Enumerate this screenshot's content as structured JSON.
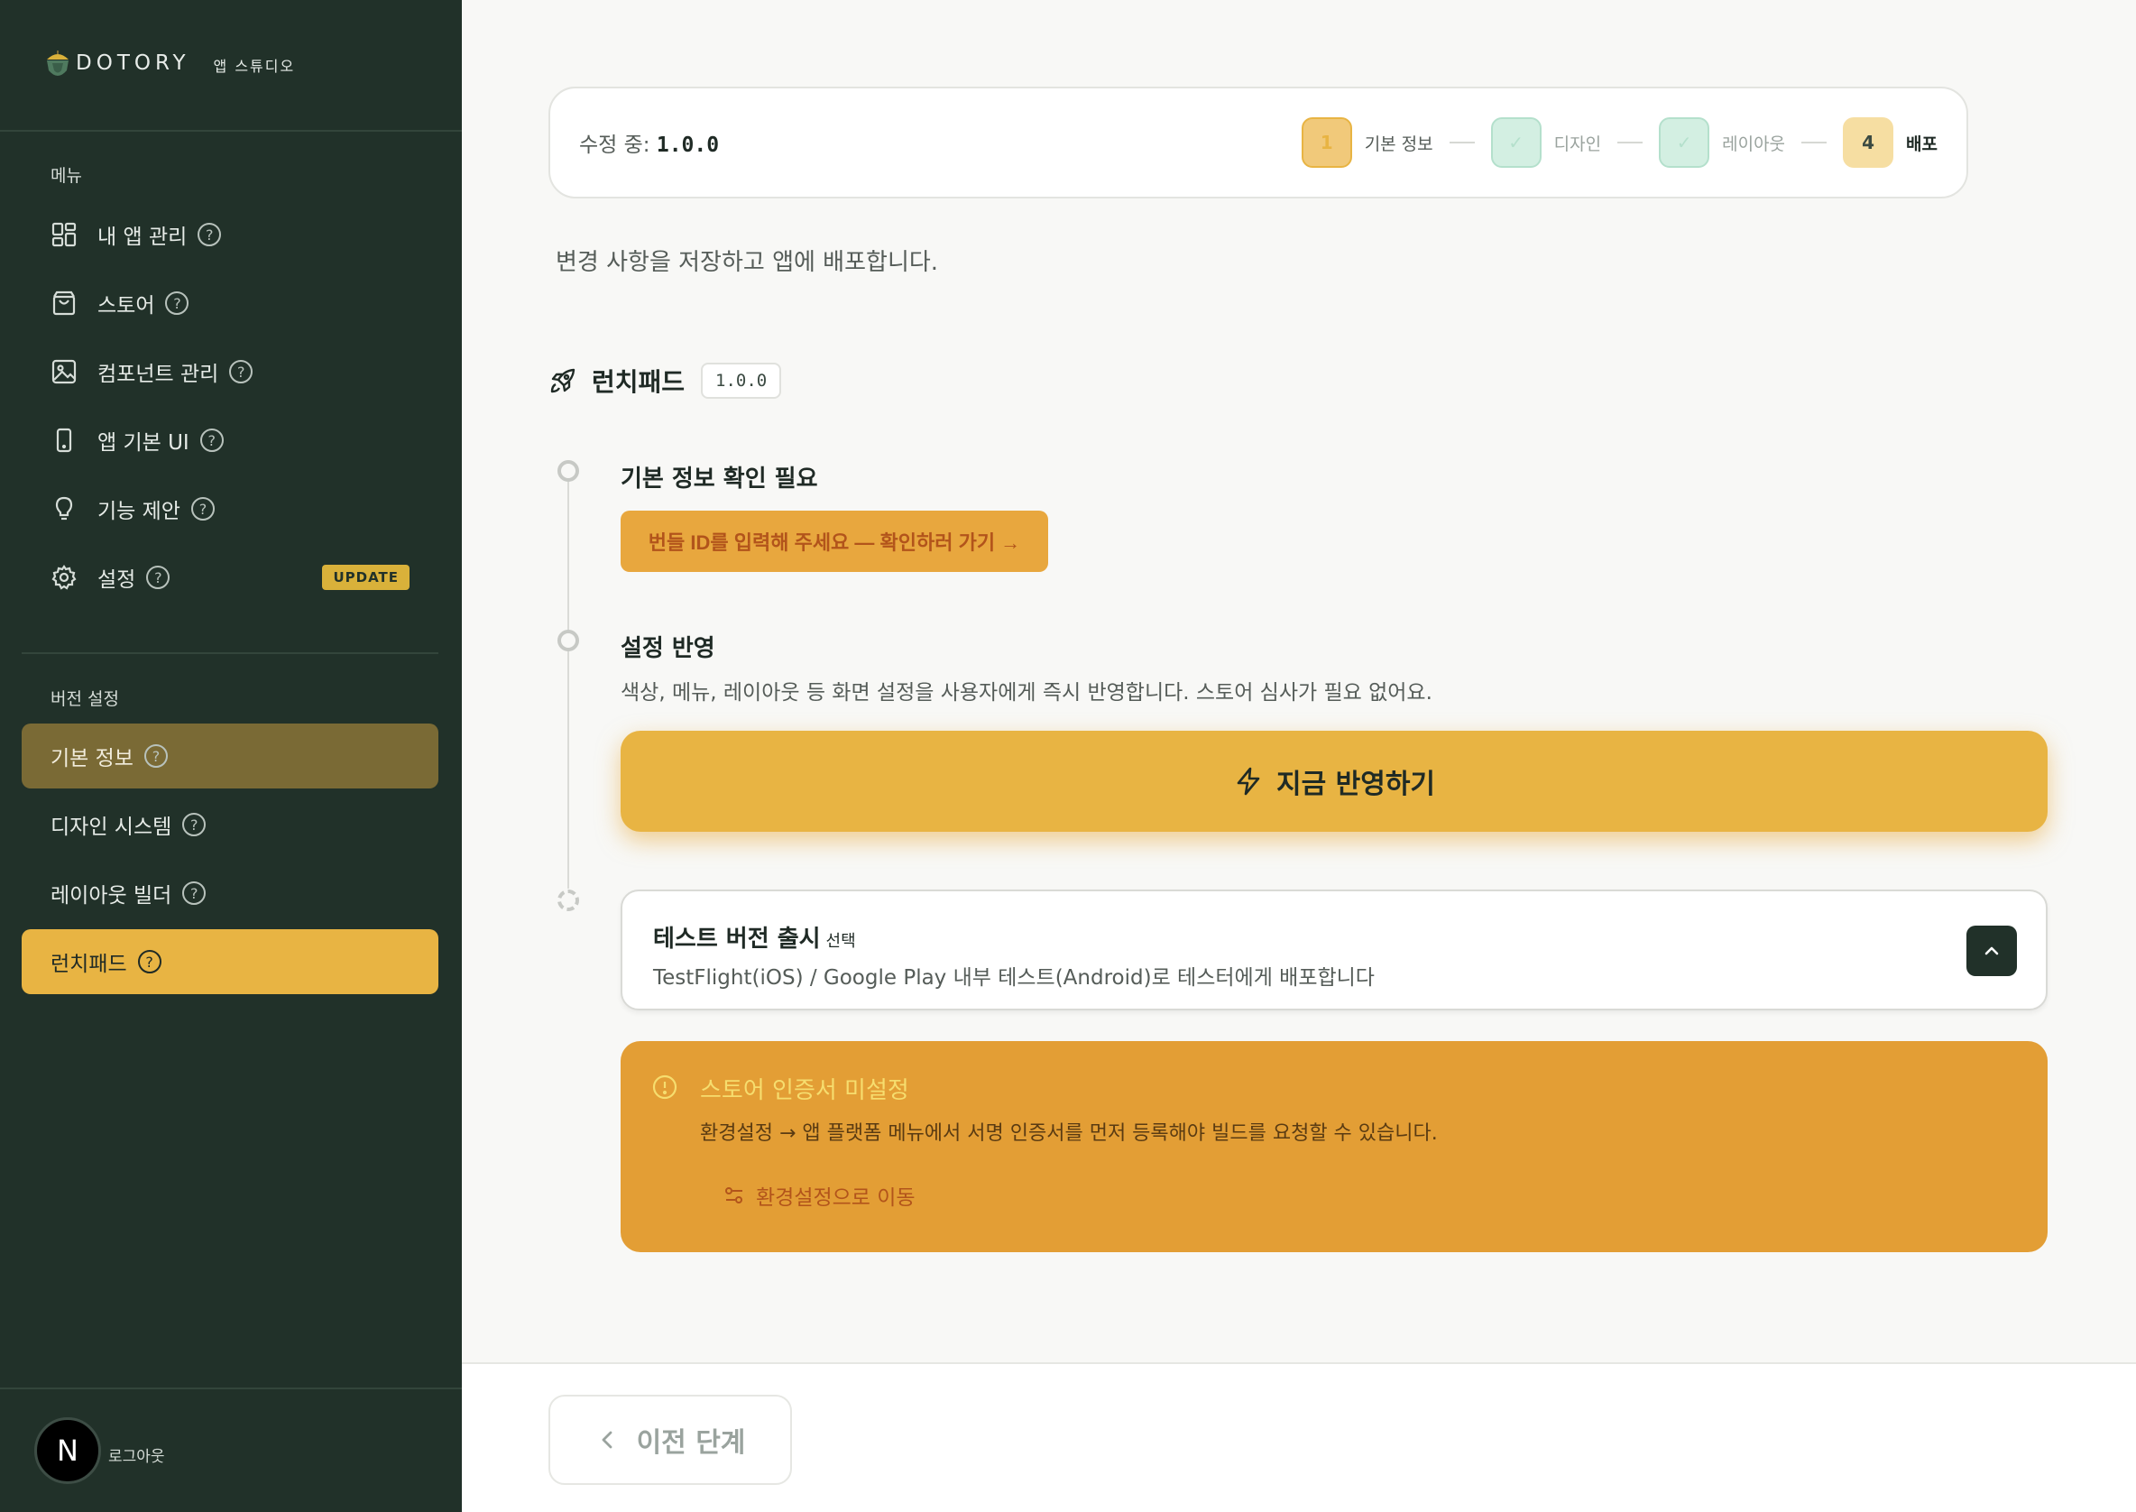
{
  "brand": {
    "name": "DOTORY",
    "subtitle": "앱 스튜디오"
  },
  "sidebar": {
    "menu_label": "메뉴",
    "items": [
      {
        "label": "내 앱 관리",
        "icon": "grid-icon"
      },
      {
        "label": "스토어",
        "icon": "bag-icon"
      },
      {
        "label": "컴포넌트 관리",
        "icon": "image-icon"
      },
      {
        "label": "앱 기본 UI",
        "icon": "phone-icon"
      },
      {
        "label": "기능 제안",
        "icon": "lightbulb-icon"
      },
      {
        "label": "설정",
        "icon": "gear-icon",
        "badge": "UPDATE"
      }
    ],
    "version_label": "버전 설정",
    "version_items": [
      {
        "label": "기본 정보",
        "state": "done"
      },
      {
        "label": "디자인 시스템",
        "state": "idle"
      },
      {
        "label": "레이아웃 빌더",
        "state": "idle"
      },
      {
        "label": "런치패드",
        "state": "active"
      }
    ],
    "help_glyph": "?",
    "user": {
      "avatar_letter": "N",
      "logout": "로그아웃"
    }
  },
  "header": {
    "editing_prefix": "수정 중: ",
    "editing_version": "1.0.0",
    "steps": [
      {
        "num": "1",
        "label": "기본 정보"
      },
      {
        "num": "✓",
        "label": "디자인"
      },
      {
        "num": "✓",
        "label": "레이아웃"
      },
      {
        "num": "4",
        "label": "배포"
      }
    ]
  },
  "main": {
    "subtitle": "변경 사항을 저장하고 앱에 배포합니다.",
    "launchpad_title": "런치패드",
    "launchpad_version": "1.0.0",
    "step1_title": "기본 정보 확인 필요",
    "step1_button": "번들 ID를 입력해 주세요 — 확인하러 가기 →",
    "step2_title": "설정 반영",
    "step2_desc": "색상, 메뉴, 레이아웃 등 화면 설정을 사용자에게 즉시 반영합니다. 스토어 심사가 필요 없어요.",
    "apply_button": "지금 반영하기",
    "test_title": "테스트 버전 출시",
    "test_optional": "선택",
    "test_desc": "TestFlight(iOS) / Google Play 내부 테스트(Android)로 테스터에게 배포합니다",
    "alert_title": "스토어 인증서 미설정",
    "alert_desc": "환경설정 → 앱 플랫폼 메뉴에서 서명 인증서를 먼저 등록해야 빌드를 요청할 수 있습니다.",
    "alert_link": "환경설정으로 이동"
  },
  "footer": {
    "prev_button": "이전 단계"
  },
  "colors": {
    "sidebar_bg": "#213129",
    "accent": "#e8b443",
    "warning": "#e39e35",
    "success_tint": "#d3efe2"
  }
}
